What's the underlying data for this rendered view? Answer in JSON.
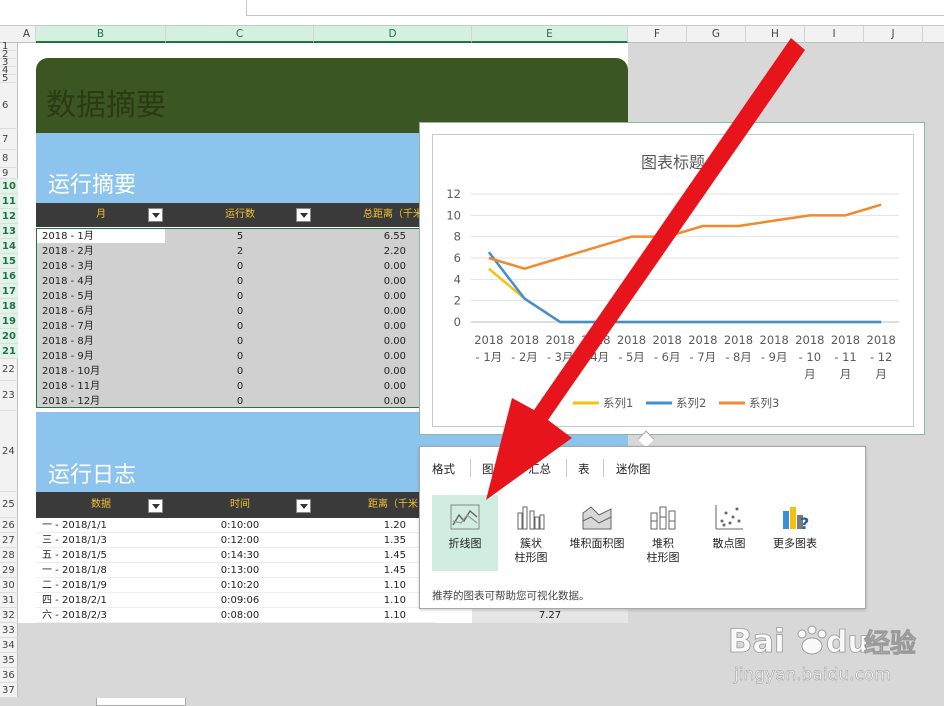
{
  "columns": [
    {
      "id": "A",
      "x": 18,
      "w": 18
    },
    {
      "id": "B",
      "x": 36,
      "w": 130
    },
    {
      "id": "C",
      "x": 166,
      "w": 148
    },
    {
      "id": "D",
      "x": 314,
      "w": 158
    },
    {
      "id": "E",
      "x": 472,
      "w": 156
    },
    {
      "id": "F",
      "x": 628,
      "w": 59
    },
    {
      "id": "G",
      "x": 687,
      "w": 59
    },
    {
      "id": "H",
      "x": 746,
      "w": 59
    },
    {
      "id": "I",
      "x": 805,
      "w": 59
    },
    {
      "id": "J",
      "x": 864,
      "w": 59
    }
  ],
  "rows": [
    "1",
    "2",
    "3",
    "4",
    "5",
    "6",
    "7",
    "8",
    "9",
    "10",
    "11",
    "12",
    "13",
    "14",
    "15",
    "16",
    "17",
    "18",
    "19",
    "20",
    "21",
    "22",
    "23",
    "24",
    "25",
    "26",
    "27",
    "28",
    "29",
    "30",
    "31",
    "32",
    "33",
    "34",
    "35",
    "36",
    "37"
  ],
  "summary": {
    "title": "数据摘要",
    "run_summary_title": "运行摘要",
    "headers": {
      "month": "月",
      "runs": "运行数",
      "distance": "总距离（千米"
    },
    "rows": [
      {
        "month": "2018 - 1月",
        "runs": "5",
        "distance": "6.55"
      },
      {
        "month": "2018 - 2月",
        "runs": "2",
        "distance": "2.20"
      },
      {
        "month": "2018 - 3月",
        "runs": "0",
        "distance": "0.00"
      },
      {
        "month": "2018 - 4月",
        "runs": "0",
        "distance": "0.00"
      },
      {
        "month": "2018 - 5月",
        "runs": "0",
        "distance": "0.00"
      },
      {
        "month": "2018 - 6月",
        "runs": "0",
        "distance": "0.00"
      },
      {
        "month": "2018 - 7月",
        "runs": "0",
        "distance": "0.00"
      },
      {
        "month": "2018 - 8月",
        "runs": "0",
        "distance": "0.00"
      },
      {
        "month": "2018 - 9月",
        "runs": "0",
        "distance": "0.00"
      },
      {
        "month": "2018 - 10月",
        "runs": "0",
        "distance": "0.00"
      },
      {
        "month": "2018 - 11月",
        "runs": "0",
        "distance": "0.00"
      },
      {
        "month": "2018 - 12月",
        "runs": "0",
        "distance": "0.00"
      }
    ]
  },
  "log": {
    "title": "运行日志",
    "headers": {
      "data": "数据",
      "time": "时间",
      "distance": "距离（千米"
    },
    "rows": [
      {
        "date": "一 - 2018/1/1",
        "time": "0:10:00",
        "distance": "1.20"
      },
      {
        "date": "三 - 2018/1/3",
        "time": "0:12:00",
        "distance": "1.35"
      },
      {
        "date": "五 - 2018/1/5",
        "time": "0:14:30",
        "distance": "1.45"
      },
      {
        "date": "一 - 2018/1/8",
        "time": "0:13:00",
        "distance": "1.45"
      },
      {
        "date": "二 - 2018/1/9",
        "time": "0:10:20",
        "distance": "1.10"
      },
      {
        "date": "四 - 2018/2/1",
        "time": "0:09:06",
        "distance": "1.10"
      },
      {
        "date": "六 - 2018/2/3",
        "time": "0:08:00",
        "distance": "1.10"
      }
    ],
    "extra_value": "7.27"
  },
  "chart_data": {
    "type": "line",
    "title": "图表标题",
    "categories": [
      "2018 - 1月",
      "2018 - 2月",
      "2018 - 3月",
      "2018 - 4月",
      "2018 - 5月",
      "2018 - 6月",
      "2018 - 7月",
      "2018 - 8月",
      "2018 - 9月",
      "2018 - 10月",
      "2018 - 11月",
      "2018 - 12月"
    ],
    "category_lines": [
      [
        "2018",
        "- 1月"
      ],
      [
        "2018",
        "- 2月"
      ],
      [
        "2018",
        "- 3月"
      ],
      [
        "2018",
        "- 4月"
      ],
      [
        "2018",
        "- 5月"
      ],
      [
        "2018",
        "- 6月"
      ],
      [
        "2018",
        "- 7月"
      ],
      [
        "2018",
        "- 8月"
      ],
      [
        "2018",
        "- 9月"
      ],
      [
        "2018",
        "- 10",
        "月"
      ],
      [
        "2018",
        "- 11",
        "月"
      ],
      [
        "2018",
        "- 12",
        "月"
      ]
    ],
    "yticks": [
      0,
      2,
      4,
      6,
      8,
      10,
      12
    ],
    "ylim": [
      0,
      12
    ],
    "grid": true,
    "legend": "bottom",
    "series": [
      {
        "name": "系列1",
        "color": "#f5c20a",
        "values": [
          5,
          2.2,
          0,
          0,
          0,
          0,
          0,
          0,
          0,
          0,
          0,
          0
        ]
      },
      {
        "name": "系列2",
        "color": "#3f8fd6",
        "values": [
          6.55,
          2.2,
          0,
          0,
          0,
          0,
          0,
          0,
          0,
          0,
          0,
          0
        ]
      },
      {
        "name": "系列3",
        "color": "#f08a2c",
        "values": [
          6,
          5,
          6,
          7,
          8,
          8,
          9,
          9,
          9.5,
          10,
          10,
          11
        ]
      }
    ]
  },
  "recommend": {
    "tabs": [
      "格式",
      "图表",
      "汇总",
      "表",
      "迷你图"
    ],
    "items": [
      {
        "label1": "折线图",
        "label2": "",
        "icon": "line-chart-icon"
      },
      {
        "label1": "簇状",
        "label2": "柱形图",
        "icon": "column-chart-icon"
      },
      {
        "label1": "堆积面积图",
        "label2": "",
        "icon": "area-chart-icon"
      },
      {
        "label1": "堆积",
        "label2": "柱形图",
        "icon": "stacked-column-icon"
      },
      {
        "label1": "散点图",
        "label2": "",
        "icon": "scatter-chart-icon"
      },
      {
        "label1": "更多图表",
        "label2": "",
        "icon": "more-charts-icon"
      }
    ],
    "hint": "推荐的图表可帮助您可视化数据。"
  },
  "watermark": {
    "brand": "Bai",
    "brand2": "du",
    "site_cn": "经验",
    "url": "jingyan.baidu.com"
  },
  "colors": {
    "accent_green": "#217346",
    "banner_green": "#3c5623",
    "band_blue": "#8dc4ee",
    "arrow_red": "#e8141c"
  }
}
